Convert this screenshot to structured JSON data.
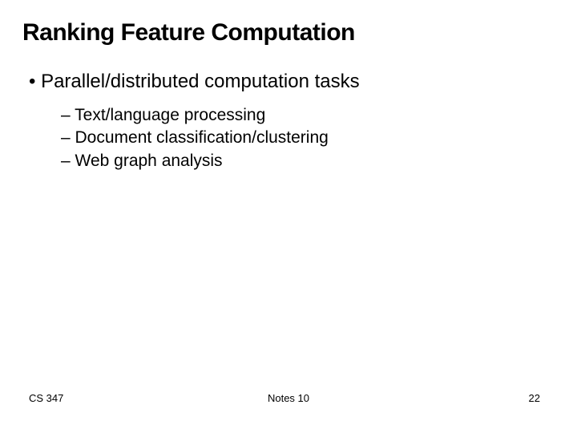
{
  "title": "Ranking Feature Computation",
  "bullet_main": "• Parallel/distributed computation tasks",
  "sub1": "– Text/language processing",
  "sub2": "– Document classification/clustering",
  "sub3": "– Web graph analysis",
  "footer": {
    "left": "CS 347",
    "center": "Notes 10",
    "right": "22"
  }
}
